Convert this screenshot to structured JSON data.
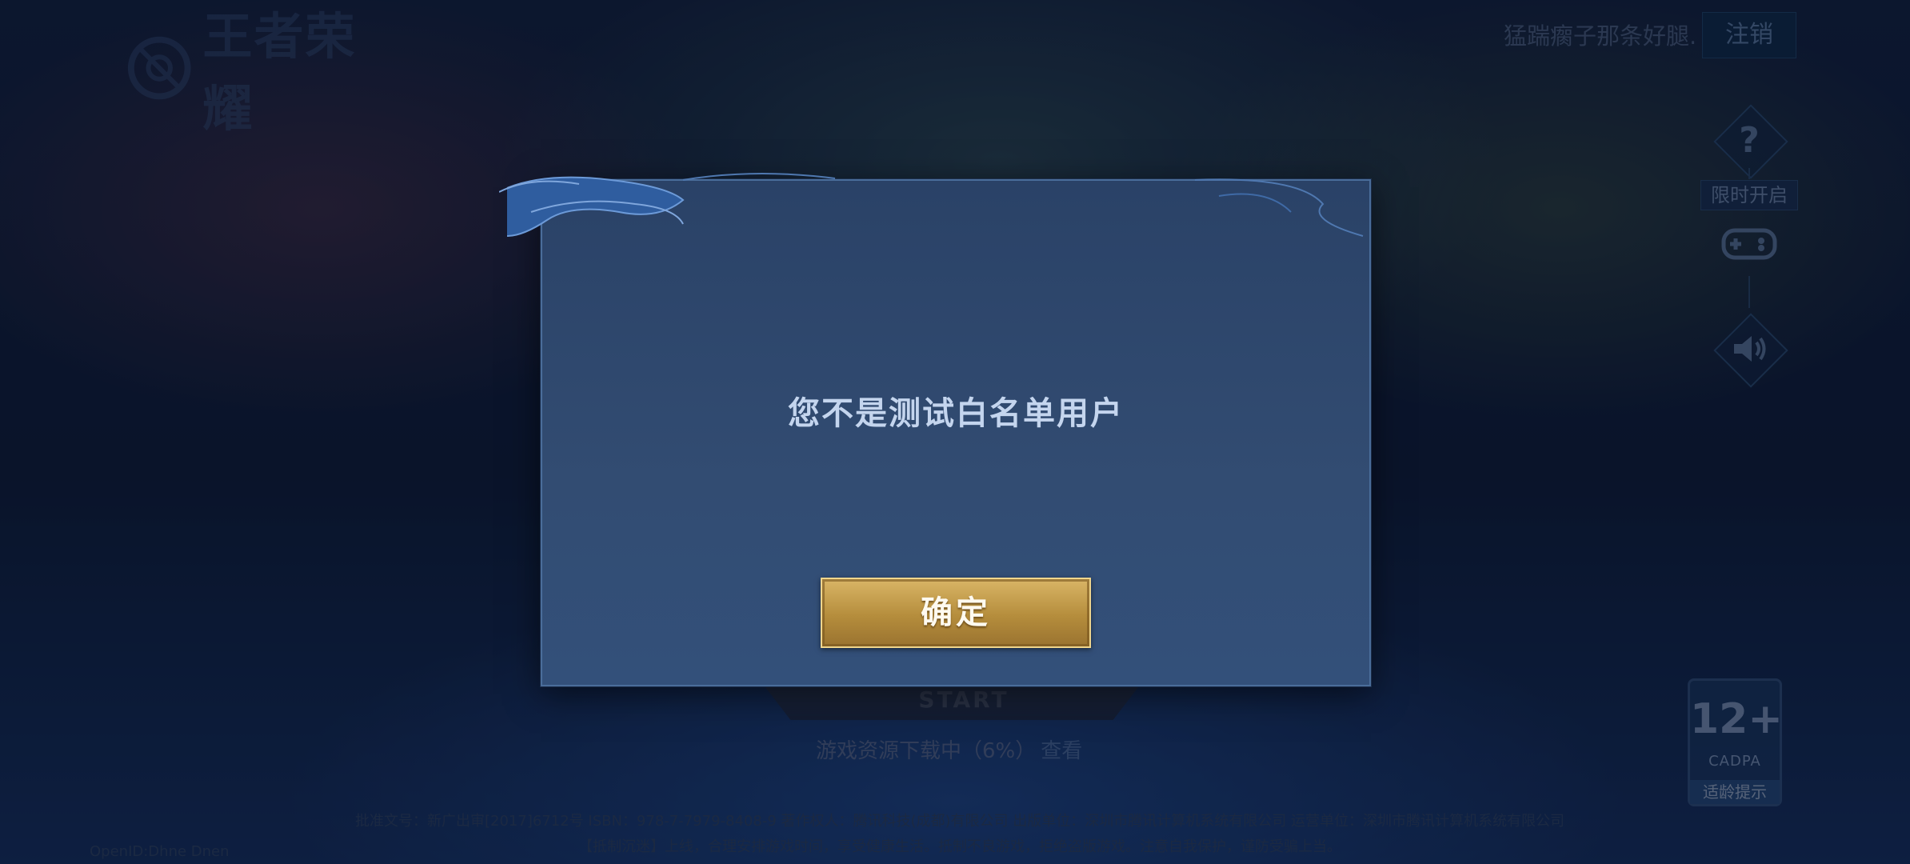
{
  "header": {
    "logo_text": "王者荣耀",
    "username": "猛踹瘸子那条好腿.",
    "logout_label": "注销"
  },
  "sidebar": {
    "help_icon": "question-icon",
    "limited_label": "限时开启",
    "gamepad_icon": "gamepad-icon",
    "sound_icon": "speaker-icon"
  },
  "main": {
    "start_label": "START",
    "download_text": "游戏资源下载中（6%）",
    "download_view": "查看"
  },
  "rating": {
    "age": "12+",
    "org": "CADPA",
    "tip": "适龄提示"
  },
  "footer": {
    "line1": "批准文号：新广出审[2017]6712号 ISBN：978-7-7979-8408-9 著作权人：腾讯科技(成都)有限公司 出版单位：深圳市腾讯计算机系统有限公司 运营单位：深圳市腾讯计算机系统有限公司",
    "line2": "【抵制沉迷】上线，合理安排游戏时间，享受健康生活。抵制不良游戏，拒绝盗版游戏。注意自我保护，谨防受骗上当。",
    "openid": "OpenID:Dhne Dnen"
  },
  "modal": {
    "message": "您不是测试白名单用户",
    "confirm_label": "确定"
  },
  "colors": {
    "accent_gold": "#d9b566",
    "modal_bg": "#2a4267",
    "modal_border": "#4a6d9a"
  }
}
